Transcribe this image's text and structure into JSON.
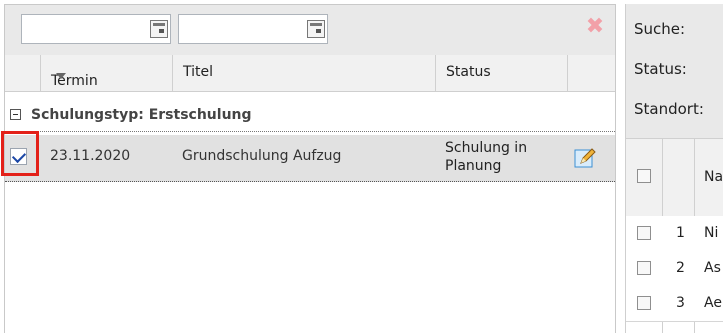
{
  "toolbar": {
    "date_from_value": "",
    "date_to_value": ""
  },
  "grid": {
    "columns": [
      "Termin",
      "Titel",
      "Status"
    ],
    "group_label": "Schulungstyp: Erstschulung",
    "rows": [
      {
        "termin": "23.11.2020",
        "titel": "Grundschulung Aufzug",
        "status_line1": "Schulung in",
        "status_line2": "Planung",
        "checked": true
      }
    ]
  },
  "filters": {
    "search_label": "Suche:",
    "status_label": "Status:",
    "location_label": "Standort:"
  },
  "side_table": {
    "header_label": "Na",
    "rows": [
      {
        "num": "1",
        "text": "Ni"
      },
      {
        "num": "2",
        "text": "As"
      },
      {
        "num": "3",
        "text": "Ae"
      }
    ]
  },
  "colors": {
    "highlight_border": "#e32119",
    "row_selected_bg": "#e1e1e1",
    "toolbar_bg": "#e9e9e9"
  }
}
